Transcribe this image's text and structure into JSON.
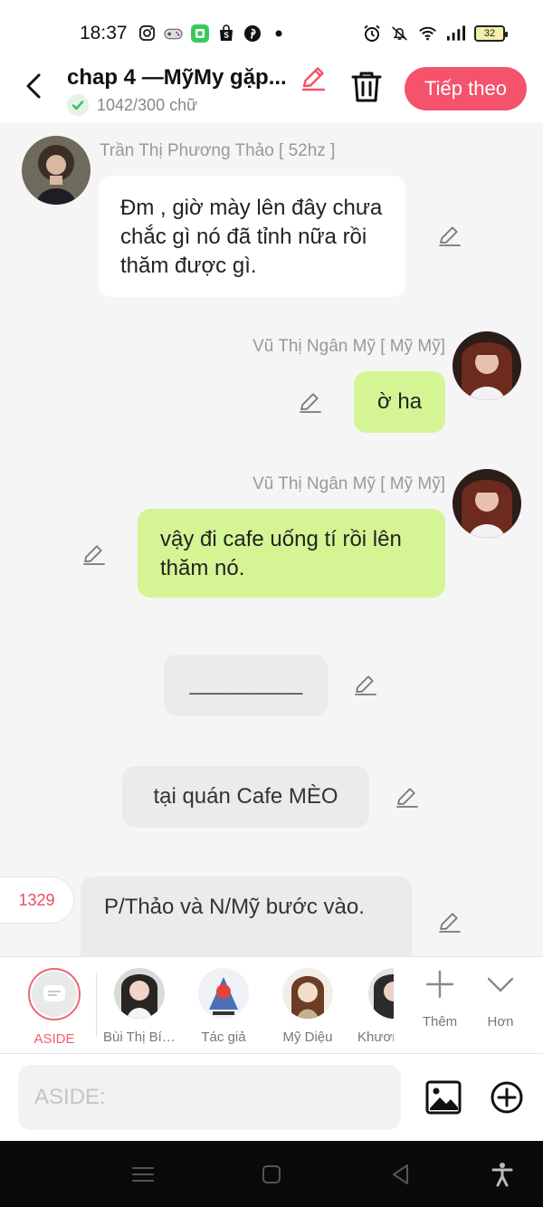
{
  "status_bar": {
    "time": "18:37",
    "battery": "32"
  },
  "header": {
    "title": "chap 4 —MỹMy gặp...",
    "word_count": "1042/300 chữ",
    "next_button": "Tiếp theo"
  },
  "messages": [
    {
      "sender": "Trần Thị Phương Thảo [ 52hz ]",
      "text": "Đm , giờ mày lên đây chưa chắc gì nó đã tỉnh nữa rồi thăm được gì."
    },
    {
      "sender": "Vũ Thị Ngân Mỹ [ Mỹ Mỹ]",
      "text": "ờ ha"
    },
    {
      "sender": "Vũ Thị Ngân Mỹ [ Mỹ Mỹ]",
      "text": "vậy đi cafe uống tí rồi lên thăm nó."
    },
    {
      "text": "__________"
    },
    {
      "text": "tại quán Cafe MÈO"
    },
    {
      "text": "P/Thảo và N/Mỹ bước vào."
    }
  ],
  "counter": "1329",
  "characters": [
    {
      "label": "ASIDE"
    },
    {
      "label": "Bùi Thị Bíc..."
    },
    {
      "label": "Tác giả"
    },
    {
      "label": "Mỹ Diệu"
    },
    {
      "label": "Khươn"
    }
  ],
  "tools": {
    "add": "Thêm",
    "more": "Hơn"
  },
  "input": {
    "placeholder": "ASIDE:"
  },
  "colors": {
    "accent": "#f4536b",
    "outgoing_bubble": "#d5f595",
    "incoming_bubble": "#ffffff",
    "narration_bubble": "#ebebeb"
  }
}
